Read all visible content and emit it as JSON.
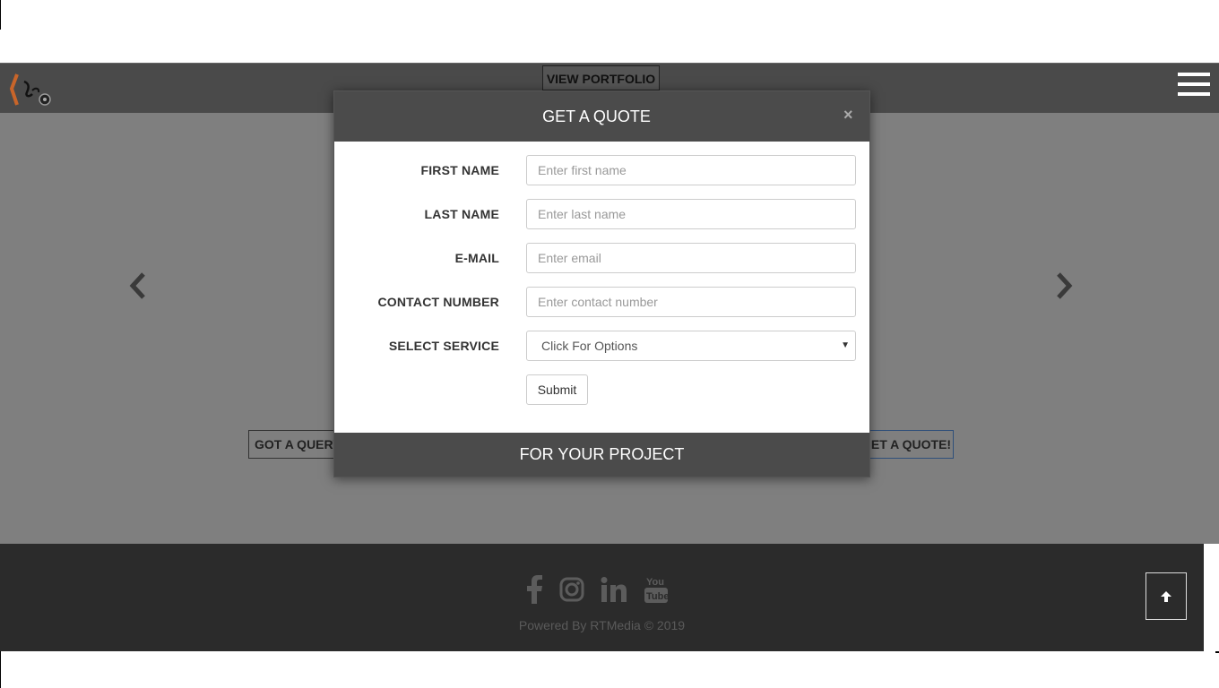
{
  "navbar": {
    "portfolio_label": "VIEW PORTFOLIO"
  },
  "carousel": {
    "left_button_label": "GOT A QUERY",
    "right_button_label": "GET A QUOTE!"
  },
  "modal": {
    "title": "GET A QUOTE",
    "close_label": "×",
    "fields": {
      "first_name": {
        "label": "FIRST NAME",
        "placeholder": "Enter first name",
        "value": ""
      },
      "last_name": {
        "label": "LAST NAME",
        "placeholder": "Enter last name",
        "value": ""
      },
      "email": {
        "label": "E-MAIL",
        "placeholder": "Enter email",
        "value": ""
      },
      "contact": {
        "label": "CONTACT NUMBER",
        "placeholder": "Enter contact number",
        "value": ""
      },
      "service": {
        "label": "SELECT SERVICE",
        "selected": "Click For Options"
      }
    },
    "submit_label": "Submit",
    "footer_text": "FOR YOUR PROJECT"
  },
  "footer": {
    "social_icons": [
      "facebook-icon",
      "instagram-icon",
      "linkedin-icon",
      "youtube-icon"
    ],
    "powered_text": "Powered By RTMedia © 2019"
  },
  "colors": {
    "header_bg": "#4b4b4b",
    "footer_bg": "#2b2b2b",
    "overlay_bg": "#7f7f7f"
  }
}
